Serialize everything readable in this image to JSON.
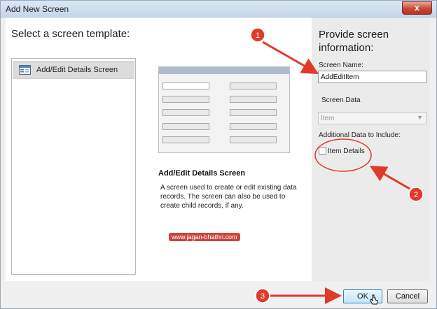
{
  "window": {
    "title": "Add New Screen",
    "close_label": "x"
  },
  "left": {
    "heading": "Select a screen template:",
    "templates": [
      {
        "label": "Add/Edit Details Screen",
        "icon": "form-template-icon"
      }
    ]
  },
  "preview": {
    "title": "Add/Edit Details Screen",
    "description": "A screen used to create or edit existing data records. The screen can also be used to create child records, if any."
  },
  "watermark": "www.jagan-bhathri.com",
  "right": {
    "heading": "Provide screen information:",
    "screen_name_label": "Screen Name:",
    "screen_name_value": "AddEditItem",
    "screen_data_label": "Screen Data",
    "screen_data_value": "Item",
    "additional_label": "Additional Data to Include:",
    "item_details_label": "Item Details"
  },
  "buttons": {
    "ok": "OK",
    "cancel": "Cancel"
  },
  "annotations": {
    "step1": "1",
    "step2": "2",
    "step3": "3",
    "color": "#e03a2a"
  }
}
